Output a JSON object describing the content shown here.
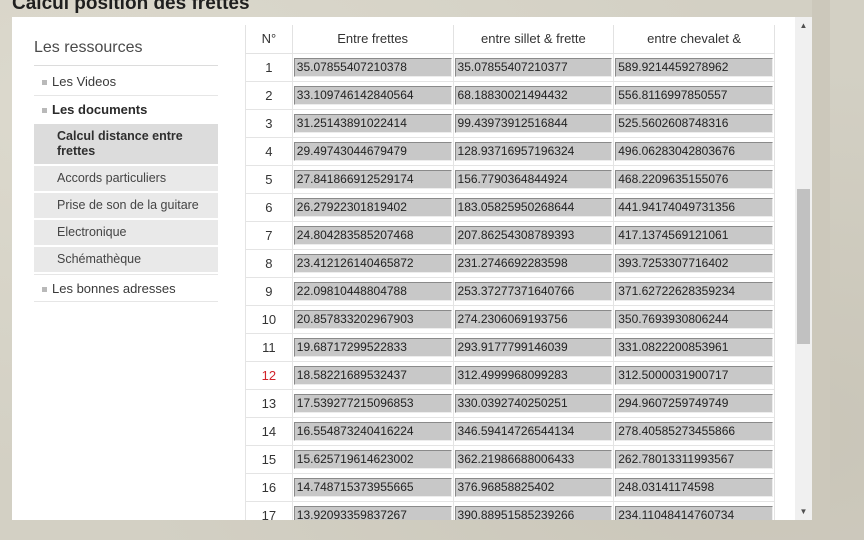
{
  "page_title": "Calcul position des frettes",
  "sidebar": {
    "title": "Les ressources",
    "items": [
      {
        "label": "Les Videos"
      },
      {
        "label": "Les documents"
      }
    ],
    "sub_items": [
      {
        "label": "Calcul distance entre frettes",
        "active": true
      },
      {
        "label": "Accords particuliers"
      },
      {
        "label": "Prise de son de la guitare"
      },
      {
        "label": "Electronique"
      },
      {
        "label": "Schémathèque"
      }
    ],
    "after_items": [
      {
        "label": "Les bonnes adresses"
      }
    ]
  },
  "table": {
    "headers": [
      "N°",
      "Entre frettes",
      "entre sillet & frette",
      "entre chevalet &"
    ],
    "highlight_row": "12",
    "rows": [
      [
        "1",
        "35.07855407210378",
        "35.07855407210377",
        "589.9214459278962"
      ],
      [
        "2",
        "33.109746142840564",
        "68.18830021494432",
        "556.8116997850557"
      ],
      [
        "3",
        "31.25143891022414",
        "99.43973912516844",
        "525.5602608748316"
      ],
      [
        "4",
        "29.49743044679479",
        "128.93716957196324",
        "496.06283042803676"
      ],
      [
        "5",
        "27.841866912529174",
        "156.7790364844924",
        "468.2209635155076"
      ],
      [
        "6",
        "26.27922301819402",
        "183.05825950268644",
        "441.94174049731356"
      ],
      [
        "7",
        "24.804283585207468",
        "207.86254308789393",
        "417.1374569121061"
      ],
      [
        "8",
        "23.412126140465872",
        "231.2746692283598",
        "393.7253307716402"
      ],
      [
        "9",
        "22.09810448804788",
        "253.37277371640766",
        "371.62722628359234"
      ],
      [
        "10",
        "20.857833202967903",
        "274.2306069193756",
        "350.7693930806244"
      ],
      [
        "11",
        "19.68717299522833",
        "293.9177799146039",
        "331.0822200853961"
      ],
      [
        "12",
        "18.58221689532437",
        "312.4999968099283",
        "312.5000031900717"
      ],
      [
        "13",
        "17.539277215096853",
        "330.0392740250251",
        "294.9607259749749"
      ],
      [
        "14",
        "16.554873240416224",
        "346.59414726544134",
        "278.40585273455866"
      ],
      [
        "15",
        "15.625719614623002",
        "362.21986688006433",
        "262.78013311993567"
      ],
      [
        "16",
        "14.748715373955665",
        "376.96858825402",
        "248.03141174598"
      ],
      [
        "17",
        "13.92093359837267",
        "390.88951585239266",
        "234.11048414760734"
      ]
    ]
  },
  "scrollbar": {
    "up_icon": "▲",
    "down_icon": "▼",
    "thumb_start": 0.33,
    "thumb_size": 0.33
  },
  "colors": {
    "highlight": "#d1232a"
  }
}
